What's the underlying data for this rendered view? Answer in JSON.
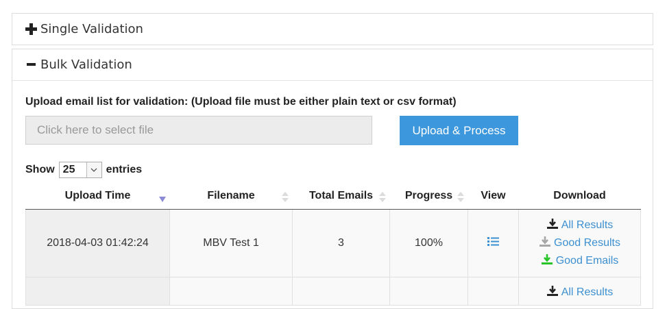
{
  "panels": {
    "single": {
      "title": "Single Validation",
      "state": "collapsed"
    },
    "bulk": {
      "title": "Bulk Validation",
      "state": "expanded"
    }
  },
  "upload": {
    "label": "Upload email list for validation: (Upload file must be either plain text or csv format)",
    "file_placeholder": "Click here to select file",
    "button": "Upload & Process"
  },
  "entries": {
    "show": "Show",
    "value": "25",
    "suffix": "entries"
  },
  "table": {
    "columns": [
      "Upload Time",
      "Filename",
      "Total Emails",
      "Progress",
      "View",
      "Download"
    ],
    "sorted_column": "Upload Time",
    "sort_direction": "desc",
    "rows": [
      {
        "upload_time": "2018-04-03 01:42:24",
        "filename": "MBV Test 1",
        "total_emails": "3",
        "progress": "100%",
        "view_icon": "list-icon",
        "downloads": [
          "All Results",
          "Good Results",
          "Good Emails"
        ]
      },
      {
        "upload_time": "",
        "filename": "",
        "total_emails": "",
        "progress": "",
        "downloads": [
          "All Results"
        ]
      }
    ]
  },
  "colors": {
    "accent": "#3c97dd",
    "link": "#3c8fd0",
    "good_emails_icon": "#27c427",
    "good_results_icon": "#a6a6a6"
  }
}
